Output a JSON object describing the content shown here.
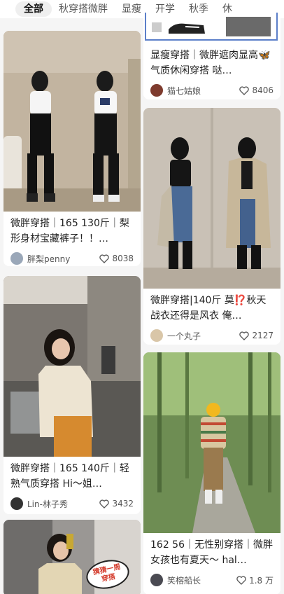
{
  "tabs": [
    {
      "label": "全部",
      "active": true
    },
    {
      "label": "秋穿搭微胖"
    },
    {
      "label": "显瘦"
    },
    {
      "label": "开学"
    },
    {
      "label": "秋季"
    },
    {
      "label": "休"
    }
  ],
  "feed": {
    "left": [
      {
        "title": "微胖穿搭｜165 130斤｜梨形身材宝藏裤子！！…",
        "author": "胖梨penny",
        "likes": "8038"
      },
      {
        "title": "微胖穿搭｜165 140斤｜轻熟气质穿搭 Hi～姐…",
        "author": "Lin-林子秀",
        "likes": "3432"
      },
      {
        "sticker": "猜猜一周穿搭"
      }
    ],
    "right": [
      {
        "title": "显瘦穿搭｜微胖遮肉显高🦋气质休闲穿搭 哒…",
        "author": "猫七姑娘",
        "likes": "8406"
      },
      {
        "title": "微胖穿搭|140斤 莫⁉️秋天战衣还得是风衣 俺…",
        "author": "一个丸子",
        "likes": "2127"
      },
      {
        "title": "162 56｜无性别穿搭｜微胖女孩也有夏天～ hal…",
        "author": "笑榕船长",
        "likes": "1.8 万"
      }
    ]
  },
  "colors": {
    "background": "#f5f5f5",
    "card": "#ffffff",
    "text": "#222222",
    "meta": "#555555"
  },
  "icons": [
    "heart-icon",
    "avatar"
  ]
}
